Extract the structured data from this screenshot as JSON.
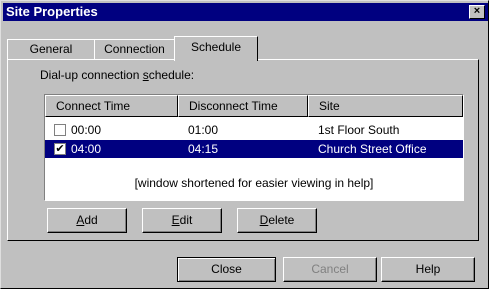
{
  "window": {
    "title": "Site Properties",
    "close_glyph": "×"
  },
  "tabs": [
    {
      "label": "General",
      "selected": false
    },
    {
      "label": "Connection",
      "selected": false
    },
    {
      "label": "Schedule",
      "selected": true
    }
  ],
  "schedule": {
    "label_pre": "Dial-up connection ",
    "label_accel": "s",
    "label_post": "chedule:",
    "columns": [
      "Connect Time",
      "Disconnect Time",
      "Site"
    ],
    "rows": [
      {
        "checked": false,
        "connect": "00:00",
        "disconnect": "01:00",
        "site": "1st Floor South",
        "selected": false
      },
      {
        "checked": true,
        "connect": "04:00",
        "disconnect": "04:15",
        "site": "Church Street Office",
        "selected": true
      }
    ],
    "check_glyph": "✔",
    "note": "[window shortened for easier viewing in help]"
  },
  "buttons": {
    "add": {
      "accel": "A",
      "rest": "dd"
    },
    "edit": {
      "accel": "E",
      "rest": "dit"
    },
    "delete": {
      "accel": "D",
      "rest": "elete"
    },
    "close": "Close",
    "cancel": "Cancel",
    "help": "Help"
  },
  "colors": {
    "titlebar": "#000080",
    "selection": "#000080",
    "face": "#c0c0c0"
  }
}
